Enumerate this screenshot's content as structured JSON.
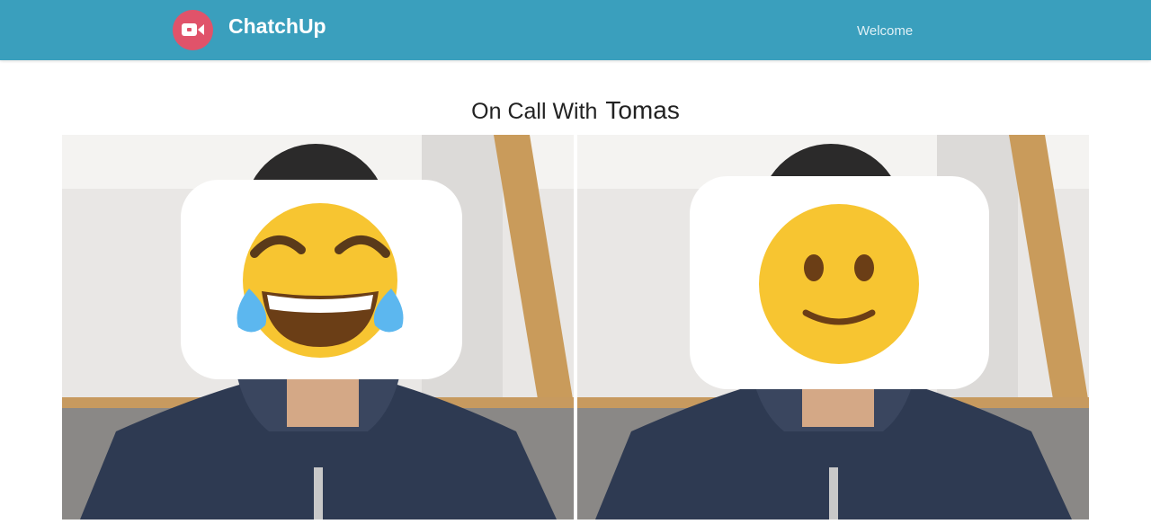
{
  "navbar": {
    "brand_icon": "video-camera-icon",
    "brand_name": "ChatchUp",
    "welcome_link": "Welcome"
  },
  "call": {
    "title_prefix": "On Call With",
    "peer_name": "Tomas"
  },
  "videos": [
    {
      "label": "local-video",
      "emoji": "tears-of-joy-emoji"
    },
    {
      "label": "remote-video",
      "emoji": "slightly-smiling-emoji"
    }
  ],
  "colors": {
    "navbar": "#3a9fbd",
    "brand_logo_bg": "#e0536a",
    "title_text": "#222222",
    "emoji_yellow": "#f7c531"
  }
}
